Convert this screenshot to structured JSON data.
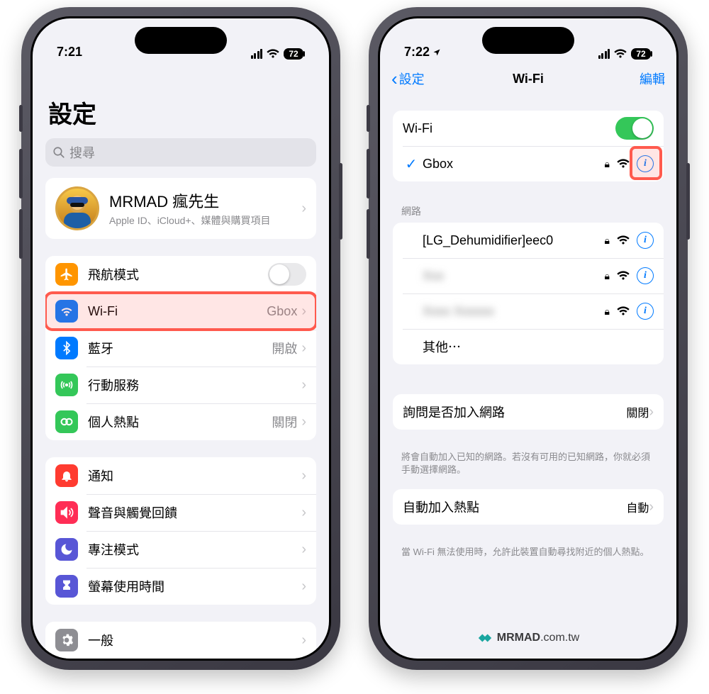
{
  "left": {
    "status": {
      "time": "7:21",
      "battery": "72"
    },
    "title": "設定",
    "search_placeholder": "搜尋",
    "profile": {
      "name": "MRMAD 瘋先生",
      "sub": "Apple ID、iCloud+、媒體與購買項目"
    },
    "rows": {
      "airplane": "飛航模式",
      "wifi": {
        "label": "Wi-Fi",
        "value": "Gbox"
      },
      "bluetooth": {
        "label": "藍牙",
        "value": "開啟"
      },
      "cellular": "行動服務",
      "hotspot": {
        "label": "個人熱點",
        "value": "關閉"
      },
      "notifications": "通知",
      "sounds": "聲音與觸覺回饋",
      "focus": "專注模式",
      "screentime": "螢幕使用時間",
      "general": "一般"
    }
  },
  "right": {
    "status": {
      "time": "7:22",
      "battery": "72"
    },
    "nav": {
      "back": "設定",
      "title": "Wi-Fi",
      "edit": "編輯"
    },
    "wifi_toggle_label": "Wi-Fi",
    "connected": "Gbox",
    "section_networks": "網路",
    "networks": [
      "[LG_Dehumidifier]eec0",
      "Xxx",
      "Xxxx Xxxxxx"
    ],
    "other": "其他⋯",
    "ask_join": {
      "label": "詢問是否加入網路",
      "value": "關閉"
    },
    "ask_join_footer": "將會自動加入已知的網路。若沒有可用的已知網路，你就必須手動選擇網路。",
    "auto_hotspot": {
      "label": "自動加入熱點",
      "value": "自動"
    },
    "auto_hotspot_footer": "當 Wi-Fi 無法使用時，允許此裝置自動尋找附近的個人熱點。"
  },
  "watermark": {
    "bold": "MRMAD",
    "rest": ".com.tw"
  },
  "colors": {
    "airplane": "#ff9500",
    "wifi": "#007aff",
    "bluetooth": "#007aff",
    "cellular": "#34c759",
    "hotspot": "#34c759",
    "notifications": "#ff3b30",
    "sounds": "#ff2d55",
    "focus": "#5856d6",
    "screentime": "#5856d6",
    "general": "#8e8e93"
  }
}
